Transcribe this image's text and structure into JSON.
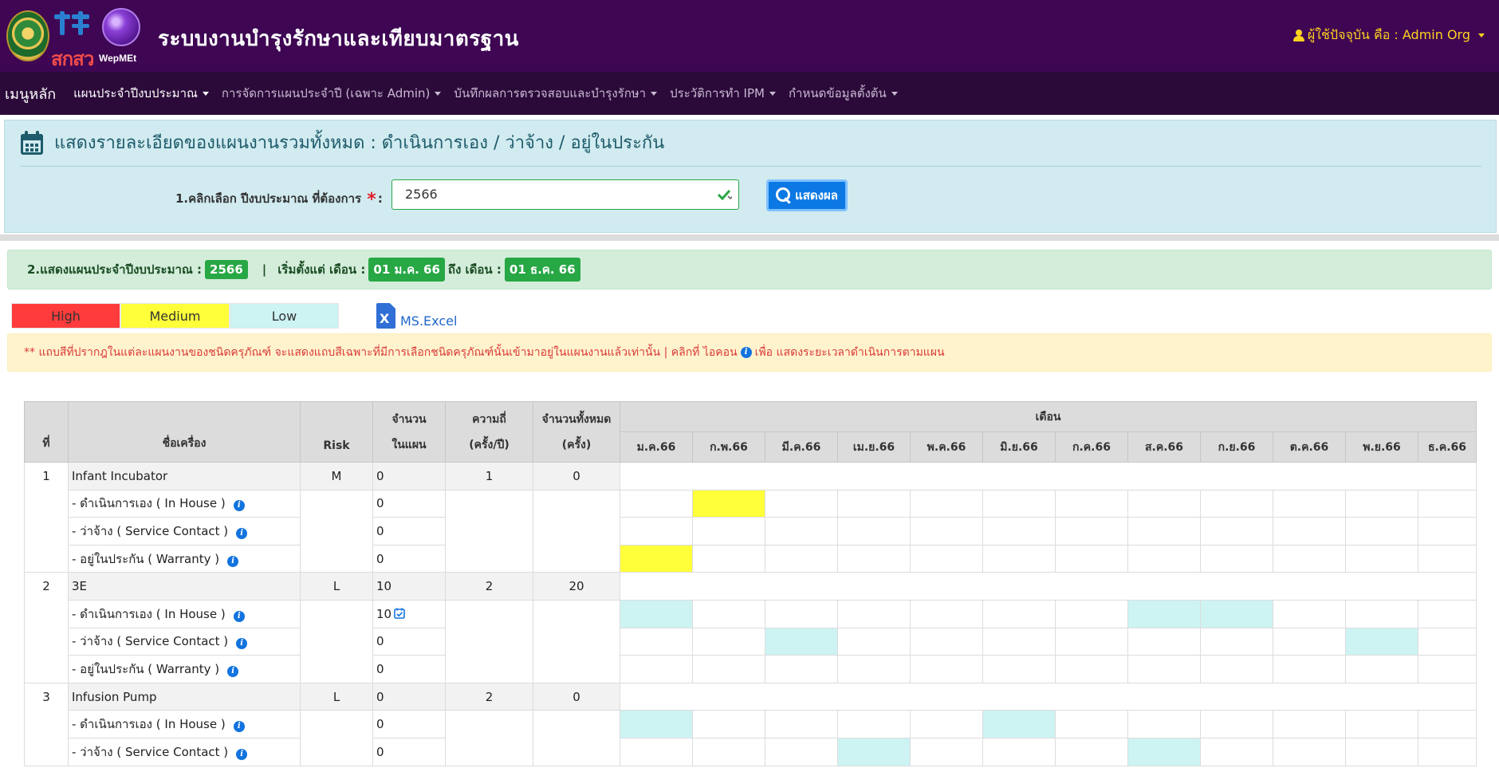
{
  "header": {
    "logo_text": "สกสว",
    "logo2_text": "WepMEt",
    "title": "ระบบงานบำรุงรักษาและเทียบมาตรฐาน",
    "user_label": "ผู้ใช้ปัจจุบัน คือ : Admin Org"
  },
  "nav": {
    "brand": "เมนูหลัก",
    "items": [
      {
        "label": "แผนประจำปีงบประมาณ"
      },
      {
        "label": "การจัดการแผนประจำปี (เฉพาะ Admin)"
      },
      {
        "label": "บันทึกผลการตรวจสอบและบำรุงรักษา"
      },
      {
        "label": "ประวัติการทำ IPM"
      },
      {
        "label": "กำหนดข้อมูลตั้งต้น"
      }
    ]
  },
  "panel1": {
    "title": "แสดงรายละเอียดของแผนงานรวมทั้งหมด : ดำเนินการเอง / ว่าจ้าง / อยู่ในประกัน",
    "year_label": "1.คลิกเลือก ปีงบประมาณ ที่ต้องการ",
    "required_mark": "*",
    "year_value": "2566",
    "show_button": "แสดงผล"
  },
  "panel2": {
    "prefix": "2.แสดงแผนประจำปีงบประมาณ :",
    "year": "2566",
    "pipe": "|",
    "start_label": "เริ่มตั้งแต่ เดือน :",
    "start": "01 ม.ค. 66",
    "end_label": "ถึง เดือน :",
    "end": "01 ธ.ค. 66"
  },
  "legend": {
    "high": "High",
    "medium": "Medium",
    "low": "Low",
    "high_color": "#ff3b3b",
    "medium_color": "#ffff3a",
    "low_color": "#cdf3f3"
  },
  "excel_label": "MS.Excel",
  "note": {
    "text1": "** แถบสีที่ปรากฎในแต่ละแผนงานของชนิดครุภัณฑ์ จะแสดงแถบสีเฉพาะที่มีการเลือกชนิดครุภัณฑ์นั้นเข้ามาอยู่ในแผนงานแล้วเท่านั้น",
    "text2": "| คลิกที่ ไอคอน",
    "text3": "เพื่อ แสดงระยะเวลาดำเนินการตามแผน"
  },
  "table": {
    "headers": {
      "no": "ที่",
      "name": "ชื่อเครื่อง",
      "risk": "Risk",
      "plan_count_1": "จำนวน",
      "plan_count_2": "ในแผน",
      "freq_1": "ความถี่",
      "freq_2": "(ครั้ง/ปี)",
      "total_1": "จำนวนทั้งหมด",
      "total_2": "(ครั้ง)",
      "months_group": "เดือน"
    },
    "months": [
      "ม.ค.66",
      "ก.พ.66",
      "มี.ค.66",
      "เม.ย.66",
      "พ.ค.66",
      "มิ.ย.66",
      "ก.ค.66",
      "ส.ค.66",
      "ก.ย.66",
      "ต.ค.66",
      "พ.ย.66",
      "ธ.ค.66"
    ],
    "sub_labels": {
      "inhouse": "- ดำเนินการเอง ( In House )",
      "service": "- ว่าจ้าง ( Service Contact )",
      "warranty": "- อยู่ในประกัน ( Warranty )"
    },
    "devices": [
      {
        "no": "1",
        "name": "Infant Incubator",
        "risk": "M",
        "count": "0",
        "freq": "1",
        "total": "0",
        "inhouse": {
          "count": "0",
          "months": [
            0,
            1,
            0,
            0,
            0,
            0,
            0,
            0,
            0,
            0,
            0,
            0
          ],
          "level": "me"
        },
        "service": {
          "count": "0",
          "months": [
            0,
            0,
            0,
            0,
            0,
            0,
            0,
            0,
            0,
            0,
            0,
            0
          ],
          "level": "me"
        },
        "warranty": {
          "count": "0",
          "months": [
            1,
            0,
            0,
            0,
            0,
            0,
            0,
            0,
            0,
            0,
            0,
            0
          ],
          "level": "me"
        }
      },
      {
        "no": "2",
        "name": "3E",
        "risk": "L",
        "count": "10",
        "freq": "2",
        "total": "20",
        "inhouse": {
          "count": "10",
          "months": [
            1,
            0,
            0,
            0,
            0,
            0,
            0,
            1,
            1,
            0,
            0,
            0
          ],
          "level": "lo",
          "has_icon": true
        },
        "service": {
          "count": "0",
          "months": [
            0,
            0,
            1,
            0,
            0,
            0,
            0,
            0,
            0,
            0,
            1,
            0
          ],
          "level": "lo"
        },
        "warranty": {
          "count": "0",
          "months": [
            0,
            0,
            0,
            0,
            0,
            0,
            0,
            0,
            0,
            0,
            0,
            0
          ],
          "level": "lo"
        }
      },
      {
        "no": "3",
        "name": "Infusion Pump",
        "risk": "L",
        "count": "0",
        "freq": "2",
        "total": "0",
        "inhouse": {
          "count": "0",
          "months": [
            1,
            0,
            0,
            0,
            0,
            1,
            0,
            0,
            0,
            0,
            0,
            0
          ],
          "level": "lo"
        },
        "service": {
          "count": "0",
          "months": [
            0,
            0,
            0,
            1,
            0,
            0,
            0,
            1,
            0,
            0,
            0,
            0
          ],
          "level": "lo"
        }
      }
    ]
  }
}
